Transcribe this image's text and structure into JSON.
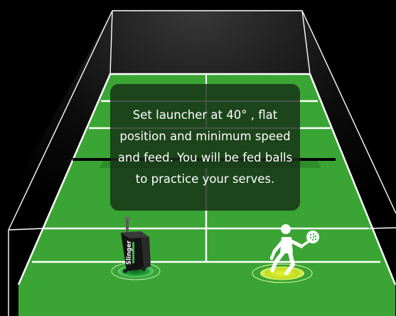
{
  "instruction": {
    "text": "Set launcher at 40° , flat position and minimum speed and feed. You will be fed balls to practice your serves."
  },
  "launcher": {
    "brand": "Slinger"
  },
  "player": {
    "icon": "padel-player-icon"
  },
  "colors": {
    "background": "#000000",
    "court_green": "#3aa534",
    "court_lines": "#ffffff",
    "glass_walls": "#ffffff",
    "net_band": "#000000",
    "launcher_glow": "#21a33a",
    "player_glow": "#c8e61e",
    "info_box": "rgba(22,48,22,0.82)"
  }
}
